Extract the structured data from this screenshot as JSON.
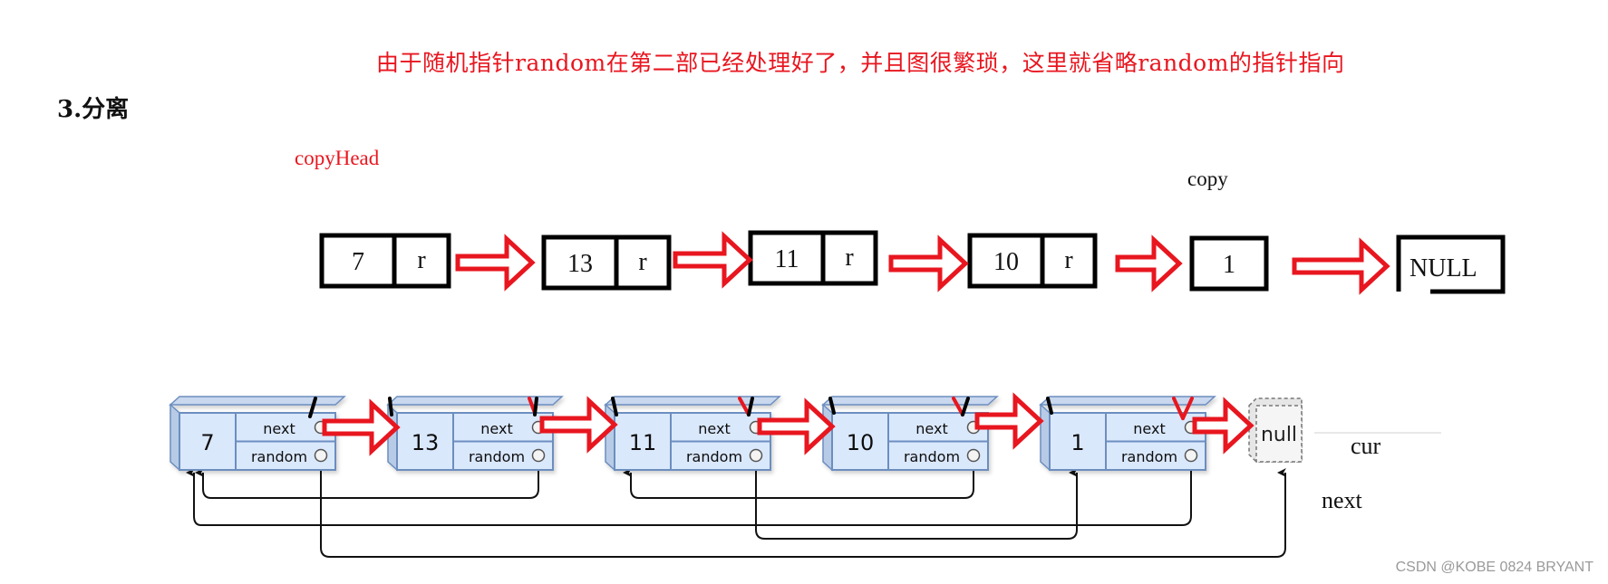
{
  "annotation_note": "由于随机指针random在第二部已经处理好了，并且图很繁琐，这里就省略random的指针指向",
  "section_heading": "3.分离",
  "labels": {
    "copy_head": "copyHead",
    "copy": "copy",
    "cur": "cur",
    "next": "next"
  },
  "copy_list": {
    "nodes": [
      {
        "val": "7",
        "ptr": "r"
      },
      {
        "val": "13",
        "ptr": "r"
      },
      {
        "val": "11",
        "ptr": "r"
      },
      {
        "val": "10",
        "ptr": "r"
      },
      {
        "val": "1",
        "ptr": ""
      }
    ],
    "terminal": "NULL"
  },
  "original_list": {
    "field_next": "next",
    "field_random": "random",
    "nodes": [
      {
        "val": "7"
      },
      {
        "val": "13"
      },
      {
        "val": "11"
      },
      {
        "val": "10"
      },
      {
        "val": "1"
      }
    ],
    "terminal": "null"
  },
  "colors": {
    "accent_red": "#e8161f",
    "node_fill": "#dae8fc",
    "node_stroke": "#6c8ebf",
    "null_fill": "#f5f5f5"
  },
  "watermark": "CSDN @KOBE 0824 BRYANT"
}
